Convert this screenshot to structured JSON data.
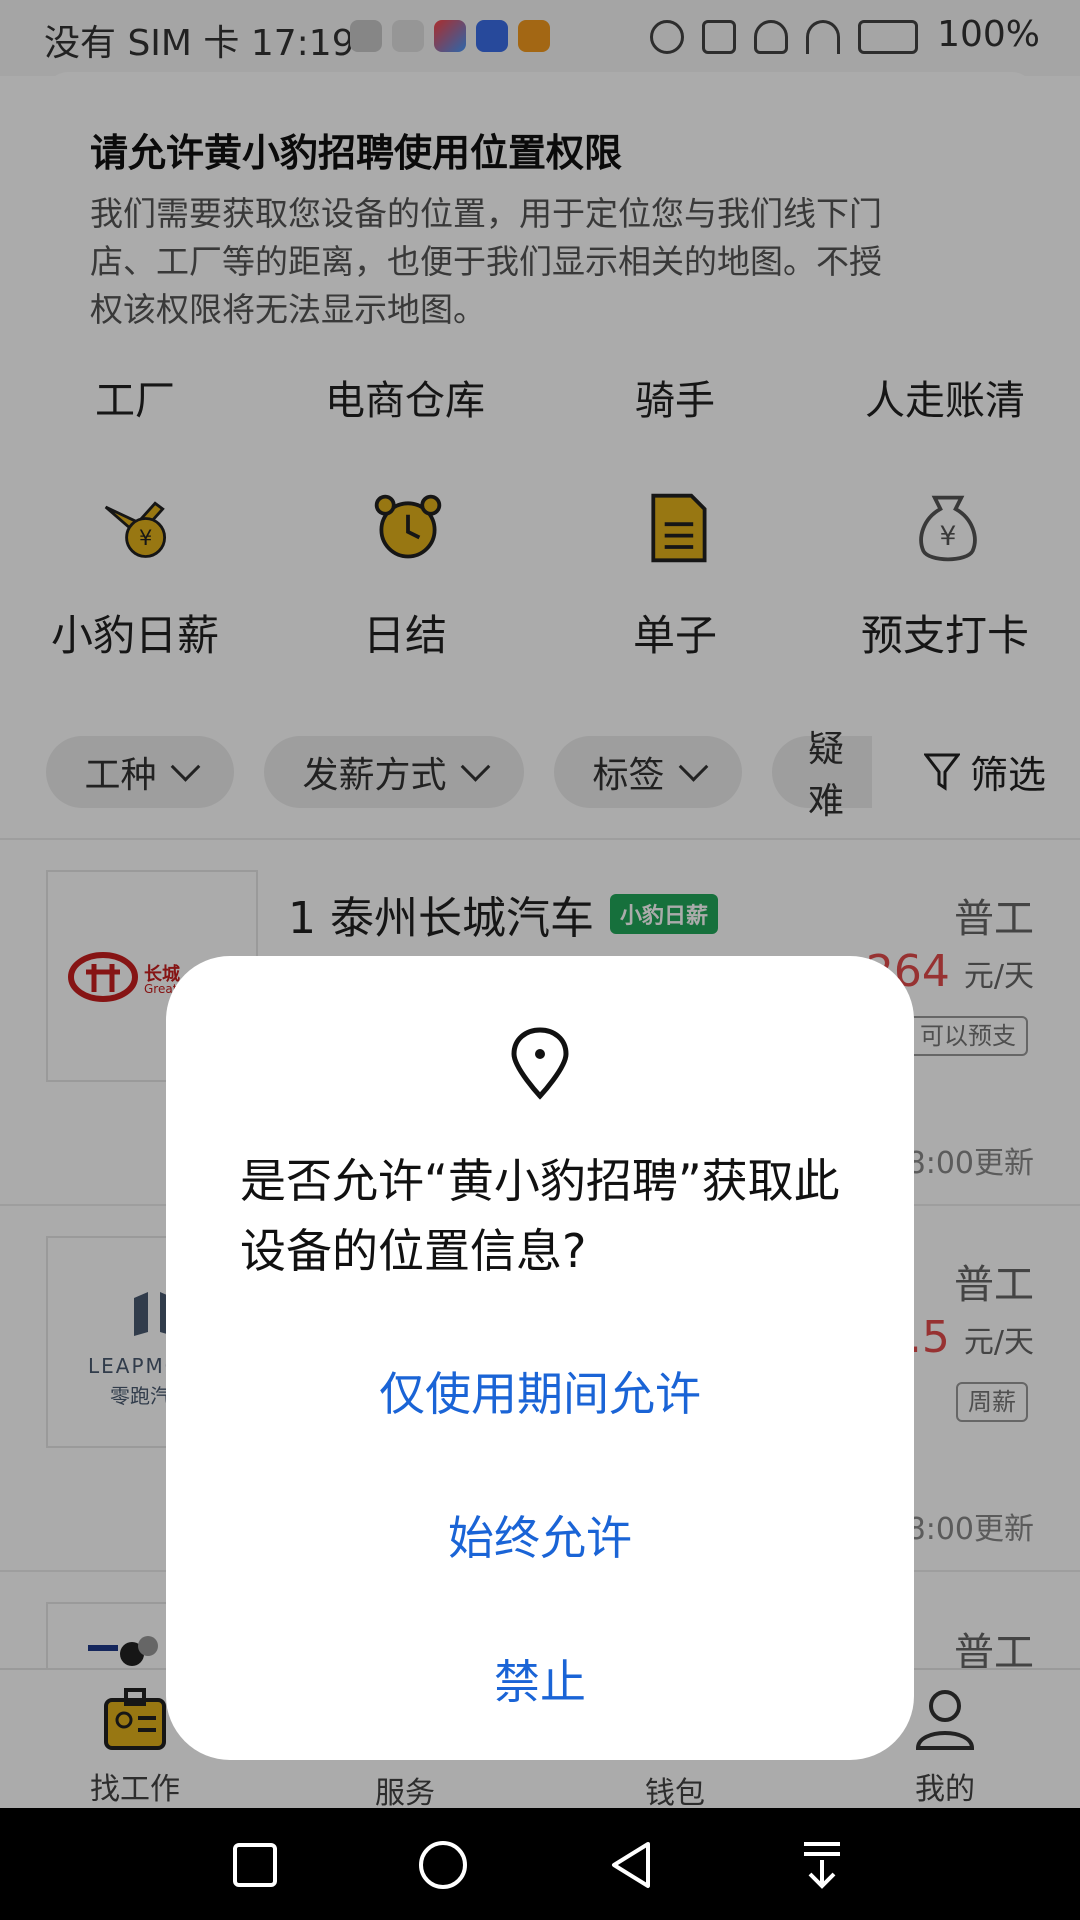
{
  "status_bar": {
    "left_text": "没有 SIM 卡 17:19",
    "right_text": "100%"
  },
  "permission_banner": {
    "title": "请允许黄小豹招聘使用位置权限",
    "body": "我们需要获取您设备的位置，用于定位您与我们线下门店、工厂等的距离，也便于我们显示相关的地图。不授权该权限将无法显示地图。"
  },
  "categories": [
    "工厂",
    "电商仓库",
    "骑手",
    "人走账清"
  ],
  "services": [
    {
      "label": "小豹日薪",
      "icon": "plane-yen-icon"
    },
    {
      "label": "日结",
      "icon": "alarm-clock-icon"
    },
    {
      "label": "单子",
      "icon": "document-icon"
    },
    {
      "label": "预支打卡",
      "icon": "money-bag-icon"
    }
  ],
  "filters": [
    "工种",
    "发薪方式",
    "标签",
    "疑难"
  ],
  "filter_button": "筛选",
  "jobs": [
    {
      "title": "1 泰州长城汽车",
      "badge": "小豹日薪",
      "type": "普工",
      "price": "264",
      "unit": "元/天",
      "tags": [
        "可以预支"
      ],
      "updated": "8:00更新",
      "logo_text": "长城",
      "logo_sub": "Great W"
    },
    {
      "title": "",
      "badge": "",
      "type": "普工",
      "price": "2.5",
      "unit": "元/天",
      "tags": [
        "周薪"
      ],
      "updated": "8:00更新",
      "logo_text": "LEAPMO",
      "logo_sub": "零跑汽"
    },
    {
      "title": "",
      "badge": "",
      "type": "普工",
      "price": "",
      "unit": "",
      "tags": [],
      "updated": "",
      "logo_text": "",
      "logo_sub": ""
    }
  ],
  "bottom_nav": [
    "找工作",
    "服务",
    "钱包",
    "我的"
  ],
  "dialog": {
    "question": "是否允许“黄小豹招聘”获取此设备的位置信息?",
    "buttons": [
      "仅使用期间允许",
      "始终允许",
      "禁止"
    ]
  },
  "colors": {
    "accent_blue": "#1a64d6",
    "brand_yellow": "#e3b21c",
    "price_red": "#e14b4b",
    "badge_green": "#22a85a"
  }
}
